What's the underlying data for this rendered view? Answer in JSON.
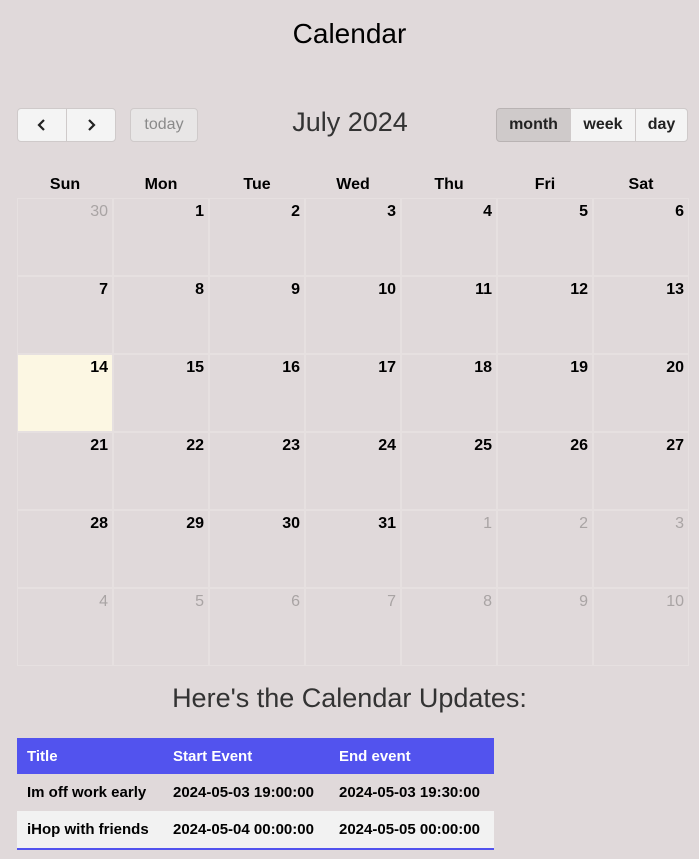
{
  "page": {
    "title": "Calendar"
  },
  "toolbar": {
    "prev_icon": "chevron-left-icon",
    "next_icon": "chevron-right-icon",
    "today_label": "today",
    "month_label": "July 2024",
    "views": [
      "month",
      "week",
      "day"
    ],
    "active_view": "month"
  },
  "calendar": {
    "weekdays": [
      "Sun",
      "Mon",
      "Tue",
      "Wed",
      "Thu",
      "Fri",
      "Sat"
    ],
    "weeks": [
      [
        "30",
        "1",
        "2",
        "3",
        "4",
        "5",
        "6"
      ],
      [
        "7",
        "8",
        "9",
        "10",
        "11",
        "12",
        "13"
      ],
      [
        "14",
        "15",
        "16",
        "17",
        "18",
        "19",
        "20"
      ],
      [
        "21",
        "22",
        "23",
        "24",
        "25",
        "26",
        "27"
      ],
      [
        "28",
        "29",
        "30",
        "31",
        "1",
        "2",
        "3"
      ],
      [
        "4",
        "5",
        "6",
        "7",
        "8",
        "9",
        "10"
      ]
    ],
    "today": "14"
  },
  "updates": {
    "heading": "Here's the Calendar Updates:",
    "columns": [
      "Title",
      "Start Event",
      "End event"
    ],
    "rows": [
      [
        "Im off work early",
        "2024-05-03 19:00:00",
        "2024-05-03 19:30:00"
      ],
      [
        "iHop with friends",
        "2024-05-04 00:00:00",
        "2024-05-05 00:00:00"
      ]
    ]
  },
  "colors": {
    "background": "#e0d9da",
    "today_highlight": "#fcf7e3",
    "table_header": "#5253ee"
  }
}
